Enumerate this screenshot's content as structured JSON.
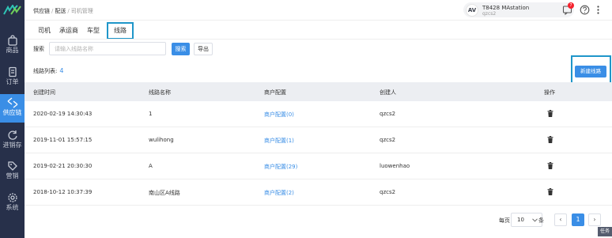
{
  "sidebar": {
    "items": [
      {
        "label": "商品",
        "icon": "bag-icon",
        "active": false
      },
      {
        "label": "订单",
        "icon": "document-icon",
        "active": false
      },
      {
        "label": "供应链",
        "icon": "exchange-icon",
        "active": true
      },
      {
        "label": "进销存",
        "icon": "refresh-icon",
        "active": false
      },
      {
        "label": "营销",
        "icon": "tag-icon",
        "active": false
      },
      {
        "label": "系统",
        "icon": "gear-icon",
        "active": false
      }
    ]
  },
  "header": {
    "breadcrumb": [
      "供应链",
      "配送",
      "司机管理"
    ],
    "account_name": "T8428 MAstation",
    "account_sub": "qzcs2",
    "avatar_text": "AV",
    "notification_count": "7"
  },
  "tabs": [
    "司机",
    "承运商",
    "车型",
    "线路"
  ],
  "toolbar": {
    "search_label": "搜索",
    "search_placeholder": "请输入线路名称",
    "search_button": "搜索",
    "export_button": "导出"
  },
  "list": {
    "title": "线路列表:",
    "count": "4",
    "new_button": "新建线路"
  },
  "table": {
    "columns": [
      "创建时间",
      "线路名称",
      "商户配置",
      "创建人",
      "操作"
    ],
    "rows": [
      {
        "created": "2020-02-19 14:30:43",
        "name": "1",
        "config": "商户配置(0)",
        "creator": "qzcs2"
      },
      {
        "created": "2019-11-01 15:57:15",
        "name": "wulihong",
        "config": "商户配置(1)",
        "creator": "qzcs2"
      },
      {
        "created": "2019-02-21 20:30:30",
        "name": "A",
        "config": "商户配置(29)",
        "creator": "luowenhao"
      },
      {
        "created": "2018-10-12 10:37:39",
        "name": "南山区A线路",
        "config": "商户配置(2)",
        "creator": "qzcs2"
      }
    ]
  },
  "pagination": {
    "per_page_label": "每页",
    "per_page_value": "10",
    "unit": "条",
    "prev": "‹",
    "current": "1",
    "next": "›"
  },
  "task_label": "任务",
  "colors": {
    "sidebar": "#27304a",
    "primary": "#3a8ee6",
    "highlight": "#1f96c9"
  }
}
